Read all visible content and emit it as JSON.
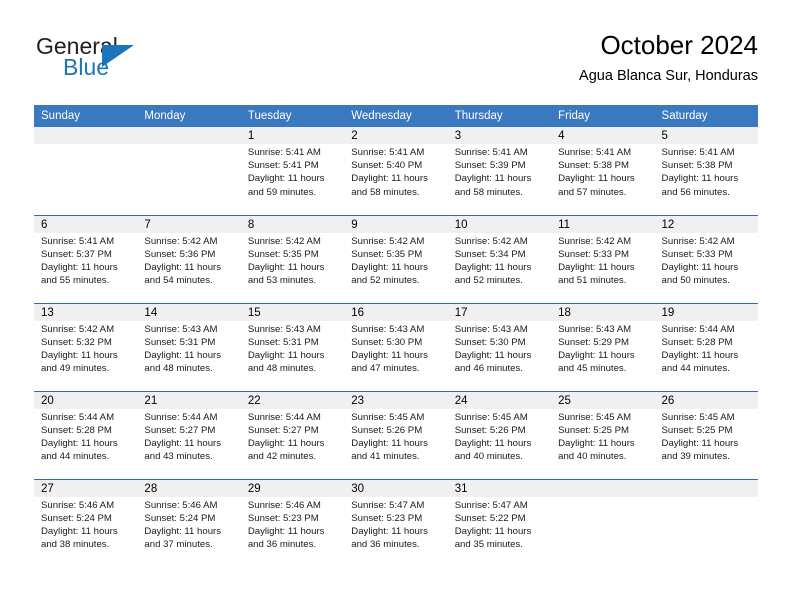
{
  "brand": {
    "name_top": "General",
    "name_bottom": "Blue",
    "color_primary": "#1b75bb",
    "color_dark": "#231f20",
    "triangle_icon": "triangle-icon"
  },
  "header": {
    "title": "October 2024",
    "subtitle": "Agua Blanca Sur, Honduras"
  },
  "theme": {
    "header_bg": "#3a78bf",
    "row_divider": "#2d6cb5",
    "daynum_bg": "#f0f0f0",
    "text": "#000000"
  },
  "calendar": {
    "weekday_headers": [
      "Sunday",
      "Monday",
      "Tuesday",
      "Wednesday",
      "Thursday",
      "Friday",
      "Saturday"
    ],
    "weeks": [
      [
        {
          "day": "",
          "sunrise": "",
          "sunset": "",
          "daylight": ""
        },
        {
          "day": "",
          "sunrise": "",
          "sunset": "",
          "daylight": ""
        },
        {
          "day": "1",
          "sunrise": "Sunrise: 5:41 AM",
          "sunset": "Sunset: 5:41 PM",
          "daylight": "Daylight: 11 hours and 59 minutes."
        },
        {
          "day": "2",
          "sunrise": "Sunrise: 5:41 AM",
          "sunset": "Sunset: 5:40 PM",
          "daylight": "Daylight: 11 hours and 58 minutes."
        },
        {
          "day": "3",
          "sunrise": "Sunrise: 5:41 AM",
          "sunset": "Sunset: 5:39 PM",
          "daylight": "Daylight: 11 hours and 58 minutes."
        },
        {
          "day": "4",
          "sunrise": "Sunrise: 5:41 AM",
          "sunset": "Sunset: 5:38 PM",
          "daylight": "Daylight: 11 hours and 57 minutes."
        },
        {
          "day": "5",
          "sunrise": "Sunrise: 5:41 AM",
          "sunset": "Sunset: 5:38 PM",
          "daylight": "Daylight: 11 hours and 56 minutes."
        }
      ],
      [
        {
          "day": "6",
          "sunrise": "Sunrise: 5:41 AM",
          "sunset": "Sunset: 5:37 PM",
          "daylight": "Daylight: 11 hours and 55 minutes."
        },
        {
          "day": "7",
          "sunrise": "Sunrise: 5:42 AM",
          "sunset": "Sunset: 5:36 PM",
          "daylight": "Daylight: 11 hours and 54 minutes."
        },
        {
          "day": "8",
          "sunrise": "Sunrise: 5:42 AM",
          "sunset": "Sunset: 5:35 PM",
          "daylight": "Daylight: 11 hours and 53 minutes."
        },
        {
          "day": "9",
          "sunrise": "Sunrise: 5:42 AM",
          "sunset": "Sunset: 5:35 PM",
          "daylight": "Daylight: 11 hours and 52 minutes."
        },
        {
          "day": "10",
          "sunrise": "Sunrise: 5:42 AM",
          "sunset": "Sunset: 5:34 PM",
          "daylight": "Daylight: 11 hours and 52 minutes."
        },
        {
          "day": "11",
          "sunrise": "Sunrise: 5:42 AM",
          "sunset": "Sunset: 5:33 PM",
          "daylight": "Daylight: 11 hours and 51 minutes."
        },
        {
          "day": "12",
          "sunrise": "Sunrise: 5:42 AM",
          "sunset": "Sunset: 5:33 PM",
          "daylight": "Daylight: 11 hours and 50 minutes."
        }
      ],
      [
        {
          "day": "13",
          "sunrise": "Sunrise: 5:42 AM",
          "sunset": "Sunset: 5:32 PM",
          "daylight": "Daylight: 11 hours and 49 minutes."
        },
        {
          "day": "14",
          "sunrise": "Sunrise: 5:43 AM",
          "sunset": "Sunset: 5:31 PM",
          "daylight": "Daylight: 11 hours and 48 minutes."
        },
        {
          "day": "15",
          "sunrise": "Sunrise: 5:43 AM",
          "sunset": "Sunset: 5:31 PM",
          "daylight": "Daylight: 11 hours and 48 minutes."
        },
        {
          "day": "16",
          "sunrise": "Sunrise: 5:43 AM",
          "sunset": "Sunset: 5:30 PM",
          "daylight": "Daylight: 11 hours and 47 minutes."
        },
        {
          "day": "17",
          "sunrise": "Sunrise: 5:43 AM",
          "sunset": "Sunset: 5:30 PM",
          "daylight": "Daylight: 11 hours and 46 minutes."
        },
        {
          "day": "18",
          "sunrise": "Sunrise: 5:43 AM",
          "sunset": "Sunset: 5:29 PM",
          "daylight": "Daylight: 11 hours and 45 minutes."
        },
        {
          "day": "19",
          "sunrise": "Sunrise: 5:44 AM",
          "sunset": "Sunset: 5:28 PM",
          "daylight": "Daylight: 11 hours and 44 minutes."
        }
      ],
      [
        {
          "day": "20",
          "sunrise": "Sunrise: 5:44 AM",
          "sunset": "Sunset: 5:28 PM",
          "daylight": "Daylight: 11 hours and 44 minutes."
        },
        {
          "day": "21",
          "sunrise": "Sunrise: 5:44 AM",
          "sunset": "Sunset: 5:27 PM",
          "daylight": "Daylight: 11 hours and 43 minutes."
        },
        {
          "day": "22",
          "sunrise": "Sunrise: 5:44 AM",
          "sunset": "Sunset: 5:27 PM",
          "daylight": "Daylight: 11 hours and 42 minutes."
        },
        {
          "day": "23",
          "sunrise": "Sunrise: 5:45 AM",
          "sunset": "Sunset: 5:26 PM",
          "daylight": "Daylight: 11 hours and 41 minutes."
        },
        {
          "day": "24",
          "sunrise": "Sunrise: 5:45 AM",
          "sunset": "Sunset: 5:26 PM",
          "daylight": "Daylight: 11 hours and 40 minutes."
        },
        {
          "day": "25",
          "sunrise": "Sunrise: 5:45 AM",
          "sunset": "Sunset: 5:25 PM",
          "daylight": "Daylight: 11 hours and 40 minutes."
        },
        {
          "day": "26",
          "sunrise": "Sunrise: 5:45 AM",
          "sunset": "Sunset: 5:25 PM",
          "daylight": "Daylight: 11 hours and 39 minutes."
        }
      ],
      [
        {
          "day": "27",
          "sunrise": "Sunrise: 5:46 AM",
          "sunset": "Sunset: 5:24 PM",
          "daylight": "Daylight: 11 hours and 38 minutes."
        },
        {
          "day": "28",
          "sunrise": "Sunrise: 5:46 AM",
          "sunset": "Sunset: 5:24 PM",
          "daylight": "Daylight: 11 hours and 37 minutes."
        },
        {
          "day": "29",
          "sunrise": "Sunrise: 5:46 AM",
          "sunset": "Sunset: 5:23 PM",
          "daylight": "Daylight: 11 hours and 36 minutes."
        },
        {
          "day": "30",
          "sunrise": "Sunrise: 5:47 AM",
          "sunset": "Sunset: 5:23 PM",
          "daylight": "Daylight: 11 hours and 36 minutes."
        },
        {
          "day": "31",
          "sunrise": "Sunrise: 5:47 AM",
          "sunset": "Sunset: 5:22 PM",
          "daylight": "Daylight: 11 hours and 35 minutes."
        },
        {
          "day": "",
          "sunrise": "",
          "sunset": "",
          "daylight": ""
        },
        {
          "day": "",
          "sunrise": "",
          "sunset": "",
          "daylight": ""
        }
      ]
    ]
  }
}
